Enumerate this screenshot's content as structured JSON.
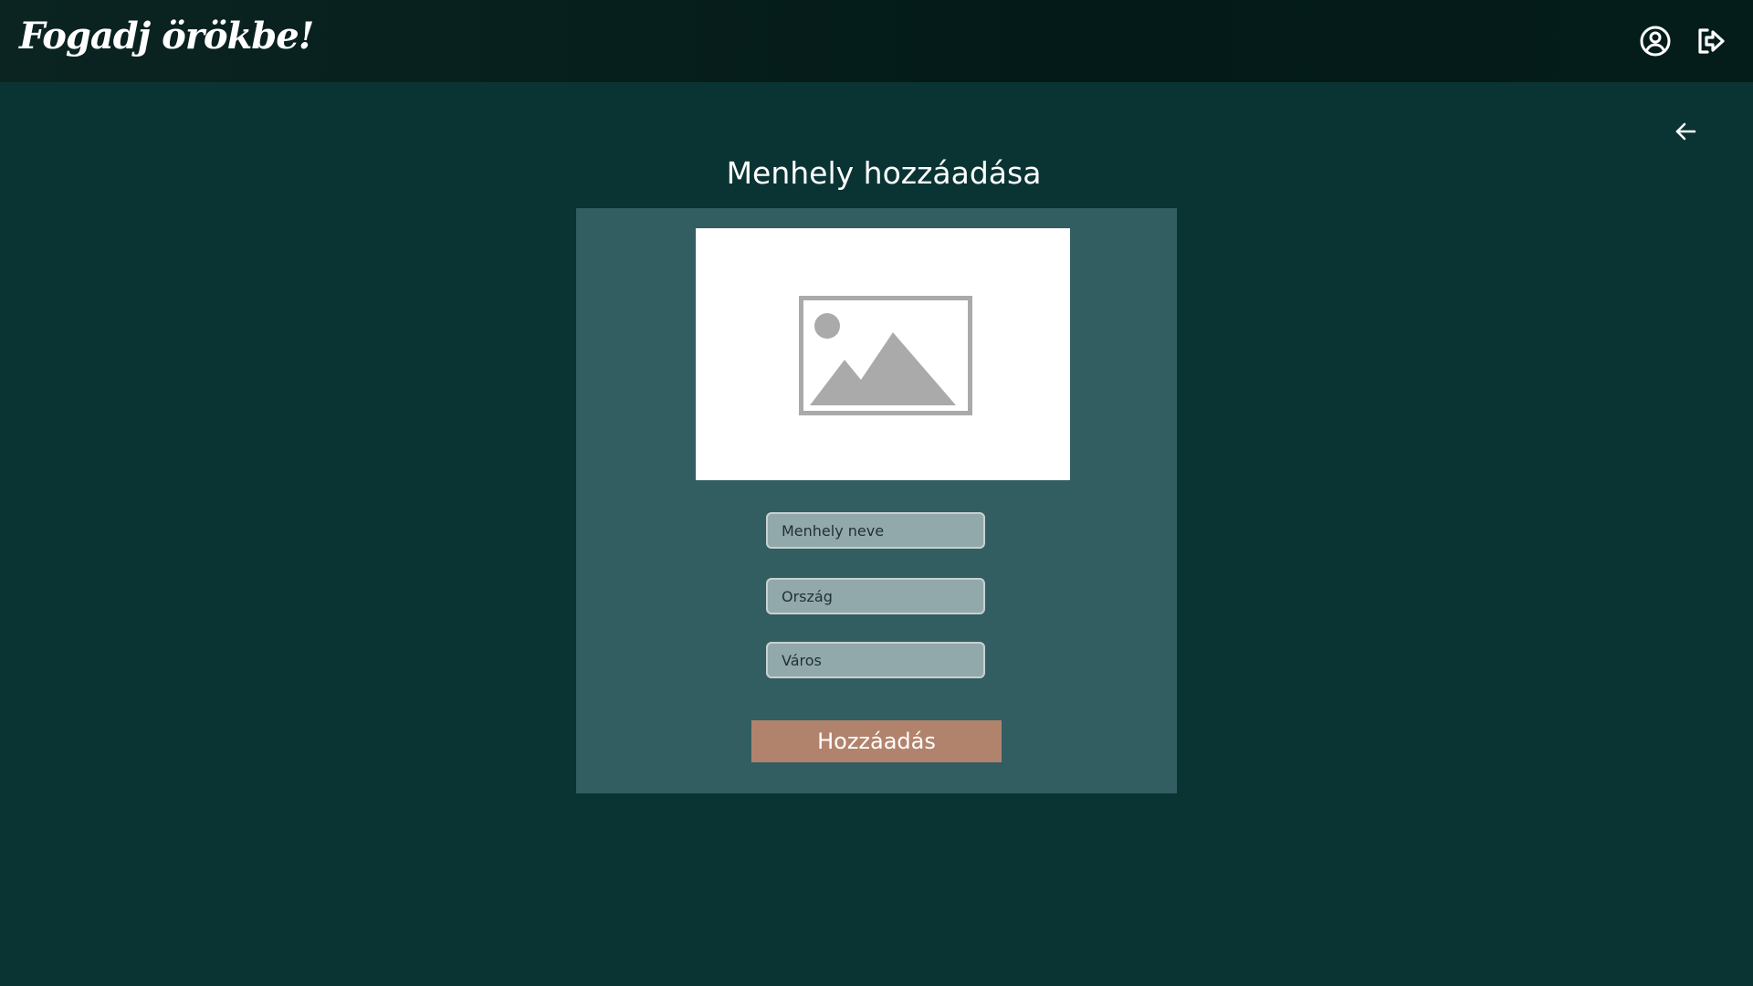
{
  "header": {
    "brand": "Fogadj örökbe!",
    "profile_icon": "user-circle-icon",
    "logout_icon": "logout-icon"
  },
  "main": {
    "back_icon": "arrow-left-icon",
    "title": "Menhely hozzáadása",
    "image_placeholder_icon": "image-placeholder-icon",
    "fields": {
      "name_placeholder": "Menhely neve",
      "country_placeholder": "Ország",
      "city_placeholder": "Város"
    },
    "submit_label": "Hozzáadás"
  },
  "colors": {
    "background": "#0a3433",
    "header": "#031a18",
    "card": "#325d61",
    "input": "#92a9ab",
    "button": "#b2836c"
  }
}
